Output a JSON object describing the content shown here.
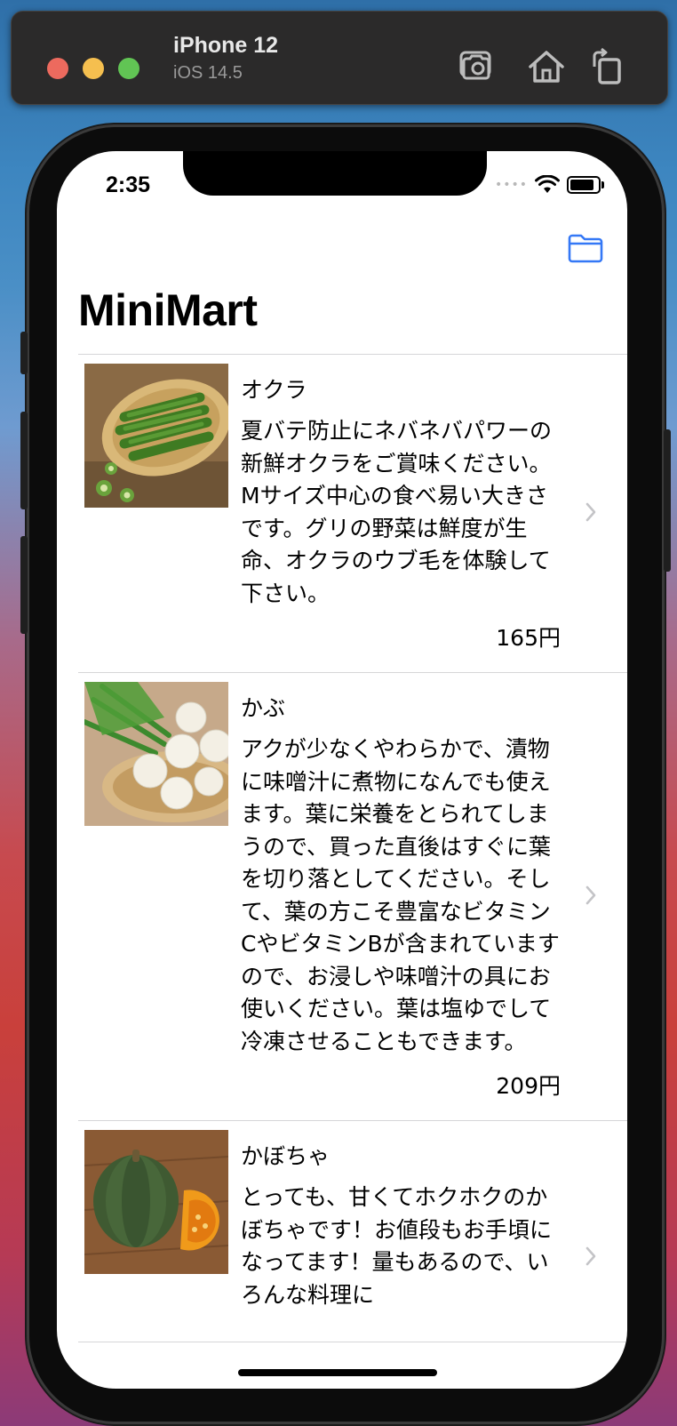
{
  "simulator": {
    "device": "iPhone 12",
    "os": "iOS 14.5",
    "icons": [
      "screenshot-icon",
      "home-icon",
      "rotate-icon"
    ]
  },
  "status_bar": {
    "time": "2:35"
  },
  "nav": {
    "title": "MiniMart",
    "right_button_icon": "folder-icon",
    "accent_color": "#3478f6"
  },
  "items": [
    {
      "name": "オクラ",
      "description": "夏バテ防止にネバネバパワーの新鮮オクラをご賞味ください。Mサイズ中心の食べ易い大きさです。グリの野菜は鮮度が生命、オクラのウブ毛を体験して下さい。",
      "price": "165円"
    },
    {
      "name": "かぶ",
      "description": "アクが少なくやわらかで、漬物に味噌汁に煮物になんでも使えます。葉に栄養をとられてしまうので、買った直後はすぐに葉を切り落としてください。そして、葉の方こそ豊富なビタミンCやビタミンBが含まれていますので、お浸しや味噌汁の具にお使いください。葉は塩ゆでして冷凍させることもできます。",
      "price": "209円"
    },
    {
      "name": "かぼちゃ",
      "description": "とっても、甘くてホクホクのかぼちゃです！お値段もお手頃になってます！量もあるので、いろんな料理に",
      "price": ""
    }
  ]
}
